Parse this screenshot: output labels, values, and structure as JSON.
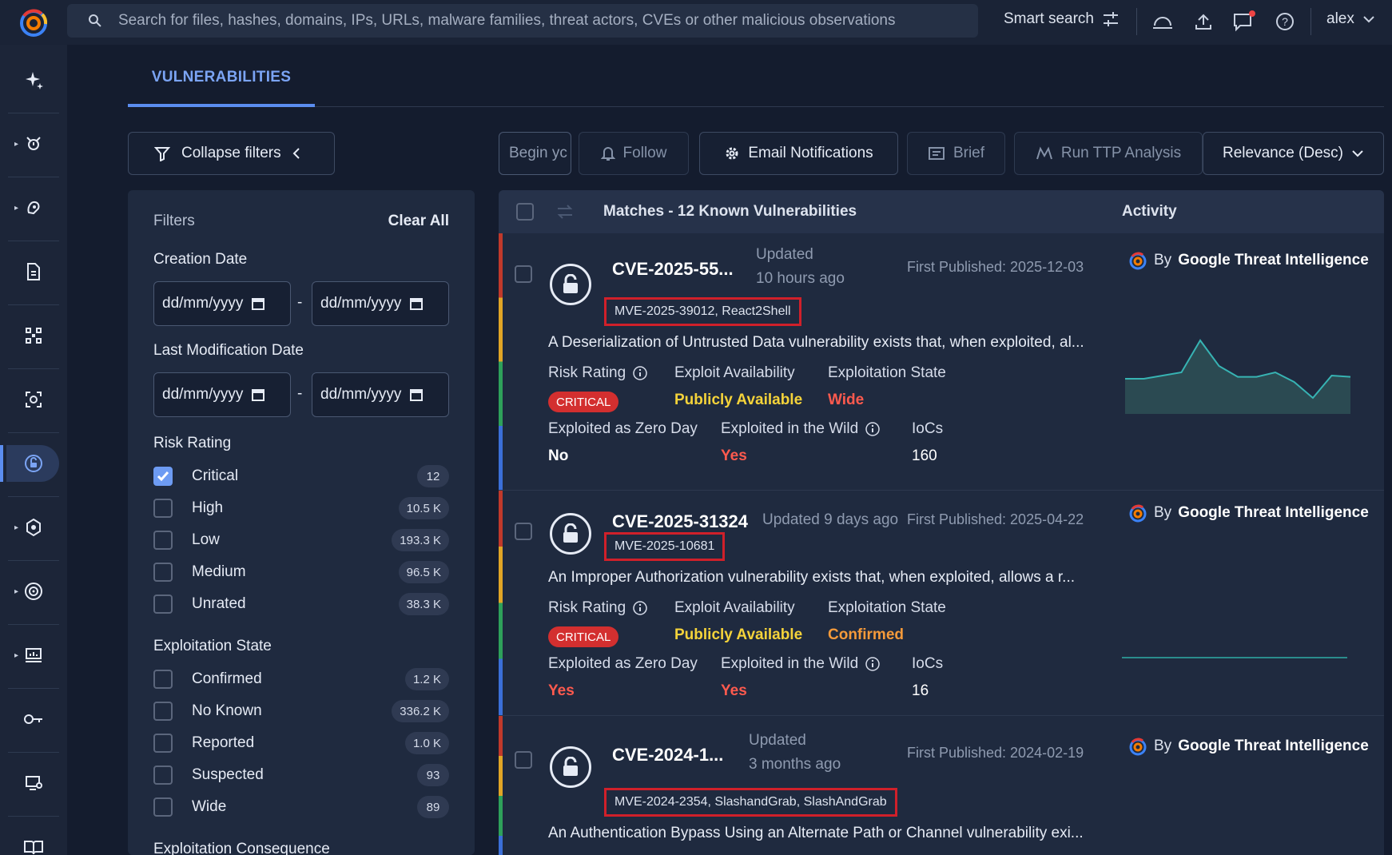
{
  "topbar": {
    "search_placeholder": "Search for files, hashes, domains, IPs, URLs, malware families, threat actors, CVEs or other malicious observations",
    "smart_search": "Smart search",
    "user": "alex"
  },
  "tabs": {
    "active": "VULNERABILITIES"
  },
  "filters": {
    "collapse_label": "Collapse filters",
    "heading": "Filters",
    "clear_all": "Clear All",
    "creation_date": "Creation Date",
    "last_mod_date": "Last Modification Date",
    "date_placeholder": "dd/mm/yyyy",
    "range_sep": "-",
    "risk_rating": {
      "title": "Risk Rating",
      "items": [
        {
          "label": "Critical",
          "count": "12",
          "checked": true
        },
        {
          "label": "High",
          "count": "10.5 K",
          "checked": false
        },
        {
          "label": "Low",
          "count": "193.3 K",
          "checked": false
        },
        {
          "label": "Medium",
          "count": "96.5 K",
          "checked": false
        },
        {
          "label": "Unrated",
          "count": "38.3 K",
          "checked": false
        }
      ]
    },
    "exploitation_state": {
      "title": "Exploitation State",
      "items": [
        {
          "label": "Confirmed",
          "count": "1.2 K",
          "checked": false
        },
        {
          "label": "No Known",
          "count": "336.2 K",
          "checked": false
        },
        {
          "label": "Reported",
          "count": "1.0 K",
          "checked": false
        },
        {
          "label": "Suspected",
          "count": "93",
          "checked": false
        },
        {
          "label": "Wide",
          "count": "89",
          "checked": false
        }
      ]
    },
    "exploitation_consequence": "Exploitation Consequence"
  },
  "actions": {
    "begin_input": "Begin yc",
    "follow": "Follow",
    "email": "Email Notifications",
    "brief": "Brief",
    "ttp": "Run TTP Analysis",
    "sort": "Relevance (Desc)"
  },
  "results": {
    "title": "Matches - 12 Known Vulnerabilities",
    "activity": "Activity",
    "labels": {
      "risk_rating": "Risk Rating",
      "exploit_availability": "Exploit Availability",
      "exploitation_state": "Exploitation State",
      "zero_day": "Exploited as Zero Day",
      "in_the_wild": "Exploited in the Wild",
      "iocs": "IoCs",
      "by": "By",
      "source": "Google Threat Intelligence"
    },
    "cards": [
      {
        "id": "CVE-2025-55...",
        "updated_line1": "Updated",
        "updated_line2": "10 hours ago",
        "first_published": "First Published: 2025-12-03",
        "aliases": "MVE-2025-39012, React2Shell",
        "description": "A Deserialization of Untrusted Data vulnerability exists that, when exploited, al...",
        "risk": "CRITICAL",
        "exploit_availability": "Publicly Available",
        "exploitation_state": "Wide",
        "zero_day": "No",
        "in_the_wild": "Yes",
        "iocs": "160",
        "activity": [
          0.35,
          0.35,
          0.4,
          0.45,
          0.95,
          0.55,
          0.38,
          0.38,
          0.45,
          0.3,
          0.05,
          0.4,
          0.38
        ]
      },
      {
        "id": "CVE-2025-31324",
        "updated_line1": "Updated 9 days ago",
        "first_published": "First Published: 2025-04-22",
        "aliases": "MVE-2025-10681",
        "description": "An Improper Authorization vulnerability exists that, when exploited, allows a r...",
        "risk": "CRITICAL",
        "exploit_availability": "Publicly Available",
        "exploitation_state": "Confirmed",
        "zero_day": "Yes",
        "in_the_wild": "Yes",
        "iocs": "16"
      },
      {
        "id": "CVE-2024-1...",
        "updated_line1": "Updated",
        "updated_line2": "3 months ago",
        "first_published": "First Published: 2024-02-19",
        "aliases": "MVE-2024-2354, SlashandGrab, SlashAndGrab",
        "description": "An Authentication Bypass Using an Alternate Path or Channel vulnerability exi..."
      }
    ]
  },
  "colors": {
    "critical": "#d32f2f",
    "publicly_available": "#f5d33a",
    "wide": "#ff5a4e",
    "confirmed": "#f59a3a",
    "yes": "#ff5a4e",
    "accent": "#5b8def"
  }
}
